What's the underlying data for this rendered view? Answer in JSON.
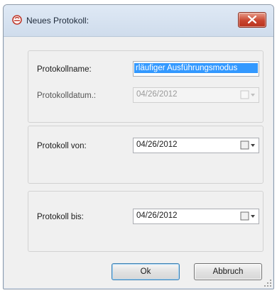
{
  "window": {
    "title": "Neues Protokoll:"
  },
  "form": {
    "name_label": "Protokollname:",
    "name_value": "rläufiger Ausführungsmodus",
    "date_label": "Protokolldatum.:",
    "date_value": "04/26/2012",
    "from_label": "Protokoll von:",
    "from_value": "04/26/2012",
    "to_label": "Protokoll bis:",
    "to_value": "04/26/2012"
  },
  "buttons": {
    "ok_label": "Ok",
    "cancel_label": "Abbruch"
  },
  "icons": {
    "app": "app-icon",
    "close": "close-icon",
    "calendar": "calendar-dropdown-icon",
    "grip": "resize-grip-icon"
  },
  "colors": {
    "selection": "#3399ff",
    "close_button": "#c9452f"
  }
}
